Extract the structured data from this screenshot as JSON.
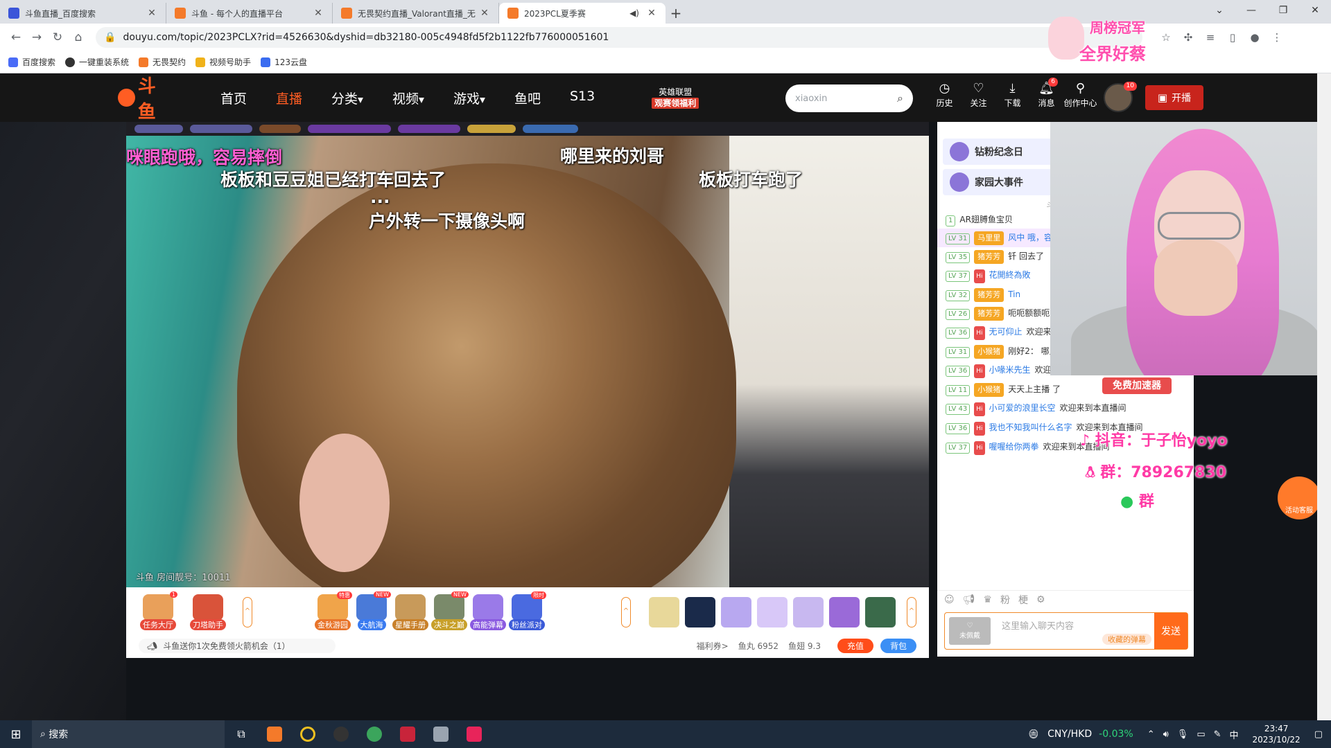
{
  "browser": {
    "tabs": [
      {
        "title": "斗鱼直播_百度搜索",
        "active": false
      },
      {
        "title": "斗鱼 - 每个人的直播平台",
        "active": false
      },
      {
        "title": "无畏契约直播_Valorant直播_无",
        "active": false
      },
      {
        "title": "2023PCL夏季赛",
        "active": true
      }
    ],
    "url": "douyu.com/topic/2023PCLX?rid=4526630&dyshid=db32180-005c4948fd5f2b1122fb776000051601",
    "bookmarks": [
      "百度搜索",
      "一键重装系统",
      "无畏契约",
      "视频号助手",
      "123云盘"
    ]
  },
  "site": {
    "logo": "斗鱼",
    "nav": [
      {
        "label": "首页",
        "active": false
      },
      {
        "label": "直播",
        "active": true
      },
      {
        "label": "分类",
        "active": false
      },
      {
        "label": "视频",
        "active": false
      },
      {
        "label": "游戏",
        "active": false
      },
      {
        "label": "鱼吧",
        "active": false
      },
      {
        "label": "S13",
        "active": false
      }
    ],
    "lol_promo": {
      "title": "英雄联盟",
      "sub": "观赛领福利"
    },
    "search_value": "xiaoxin",
    "header_icons": [
      {
        "label": "历史",
        "icon": "clock-icon"
      },
      {
        "label": "关注",
        "icon": "heart-icon"
      },
      {
        "label": "下载",
        "icon": "download-icon"
      },
      {
        "label": "消息",
        "icon": "bell-icon",
        "badge": "6"
      },
      {
        "label": "创作中心",
        "icon": "bulb-icon"
      }
    ],
    "avatar_badge": "10",
    "start_stream": "开播"
  },
  "video": {
    "danmaku": [
      "咪眼跑哦，容易摔倒",
      "哪里来的刘哥",
      "板板和豆豆姐已经打车回去了",
      "板板打车跑了",
      "...",
      "户外转一下摄像头啊"
    ],
    "room_id": "斗鱼 房间靓号：10011"
  },
  "gifts": {
    "left": [
      {
        "label": "任务大厅",
        "badge": "1"
      },
      {
        "label": "刀塔助手"
      }
    ],
    "activities": [
      {
        "label": "金秋游园",
        "tag": "特惠"
      },
      {
        "label": "大航海",
        "tag": "NEW"
      },
      {
        "label": "星耀手册"
      },
      {
        "label": "决斗之巅",
        "tag": "NEW"
      },
      {
        "label": "高能弹幕"
      },
      {
        "label": "粉丝派对",
        "tag": "限时"
      }
    ],
    "notice": "斗鱼送你1次免费领火箭机会（1）",
    "welfare": "福利券>",
    "yuwan": "鱼丸 6952",
    "yuchi": "鱼翅 9.3",
    "charge": "充值",
    "bag": "背包"
  },
  "chat": {
    "pinned": [
      "钻粉纪念日",
      "家园大事件"
    ],
    "banned_label": "斗鱼严禁未",
    "messages": [
      {
        "lv": "1",
        "text": "AR翅膊鱼宝贝"
      },
      {
        "lv": "LV 31",
        "badge": "马里里",
        "text": "风中 哦，容易摔倒",
        "hl": true
      },
      {
        "lv": "LV 35",
        "badge": "猪芳芳",
        "text": "钎 回去了"
      },
      {
        "lv": "LV 37",
        "nick": "花開終為敗",
        "text": ""
      },
      {
        "lv": "LV 32",
        "badge": "猪芳芳",
        "text": "Tin"
      },
      {
        "lv": "LV 26",
        "badge": "猪芳芳",
        "text": "呃呃额额呃呃 下摄像头啊"
      },
      {
        "lv": "LV 36",
        "nick": "无可仰止",
        "text": "欢迎来到"
      },
      {
        "lv": "LV 31",
        "badge": "小猴猪",
        "text": "刚好2： 哪里来的刘哥"
      },
      {
        "lv": "LV 36",
        "nick": "小喙米先生",
        "text": "欢迎来到本直播间"
      },
      {
        "lv": "LV 11",
        "badge": "小猴猪",
        "text": "天天上主播 了"
      },
      {
        "lv": "LV 43",
        "nick": "小可爱的浪里长空",
        "text": "欢迎来到本直播间"
      },
      {
        "lv": "LV 36",
        "nick": "我也不知我叫什么名字",
        "text": "欢迎来到本直播间"
      },
      {
        "lv": "LV 37",
        "nick": "喔喔给你两拳",
        "text": "欢迎来到本直播间"
      }
    ],
    "input_placeholder": "这里输入聊天内容",
    "unworn": "未佩戴",
    "favorite_danmaku": "收藏的弹幕",
    "send": "发送"
  },
  "overlay": {
    "top_title": "周榜冠军",
    "top_name": "全界好蔡",
    "promo": "免费加速器",
    "douyin": "抖音：于子怡yoyo",
    "qq": "群：789267830",
    "wx": "群",
    "service": "活动客服"
  },
  "taskbar": {
    "search": "搜索",
    "currency": "CNY/HKD",
    "change": "-0.03%",
    "ime": "中",
    "time": "23:47",
    "date": "2023/10/22"
  }
}
